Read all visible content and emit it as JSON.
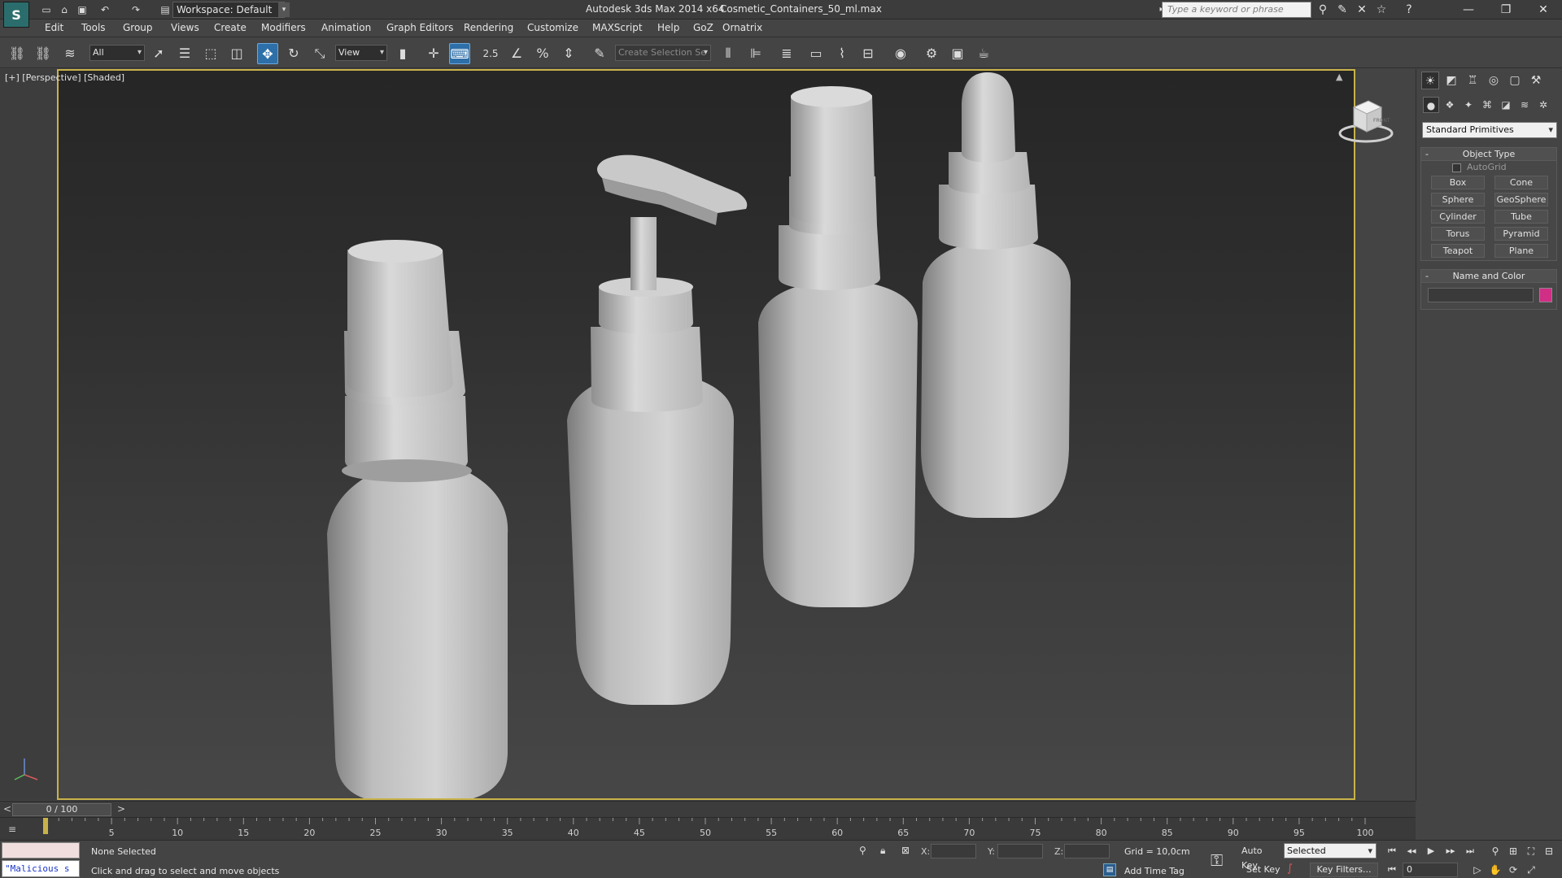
{
  "titlebar": {
    "workspace": "Workspace: Default",
    "app_title": "Autodesk 3ds Max  2014 x64",
    "file_title": "Cosmetic_Containers_50_ml.max",
    "search_placeholder": "Type a keyword or phrase"
  },
  "menu": [
    "Edit",
    "Tools",
    "Group",
    "Views",
    "Create",
    "Modifiers",
    "Animation",
    "Graph Editors",
    "Rendering",
    "Customize",
    "MAXScript",
    "Help",
    "GoZ",
    "Ornatrix"
  ],
  "toolbar": {
    "selection_filter": "All",
    "reference_coord": "View",
    "snap_label": "2.5",
    "named_selection_placeholder": "Create Selection Se"
  },
  "viewport": {
    "label": "[+] [Perspective] [Shaded]",
    "viewcube_face": "FRONT"
  },
  "command_panel": {
    "category": "Standard Primitives",
    "object_type_title": "Object Type",
    "autogrid_label": "AutoGrid",
    "primitives": [
      "Box",
      "Cone",
      "Sphere",
      "GeoSphere",
      "Cylinder",
      "Tube",
      "Torus",
      "Pyramid",
      "Teapot",
      "Plane"
    ],
    "name_color_title": "Name and Color",
    "swatch_color": "#d12e86",
    "rollout_minus": "-"
  },
  "timeline": {
    "slider_label": "0 / 100",
    "prev_arrow": "<",
    "next_arrow": ">",
    "tick_labels": [
      "5",
      "10",
      "15",
      "20",
      "25",
      "30",
      "35",
      "40",
      "45",
      "50",
      "55",
      "60",
      "65",
      "70",
      "75",
      "80",
      "85",
      "90",
      "95",
      "100"
    ]
  },
  "status": {
    "maxscript_text": "\"Malicious s",
    "selection": "None Selected",
    "prompt": "Click and drag to select and move objects",
    "x_label": "X:",
    "y_label": "Y:",
    "z_label": "Z:",
    "grid": "Grid = 10,0cm",
    "add_time_tag": "Add Time Tag",
    "auto_key": "Auto Key",
    "set_key": "Set Key",
    "key_mode": "Selected",
    "key_filters": "Key Filters...",
    "current_frame": "0"
  },
  "colors": {
    "viewport_border": "#c8b24a",
    "active_tool": "#2d6fa8"
  }
}
